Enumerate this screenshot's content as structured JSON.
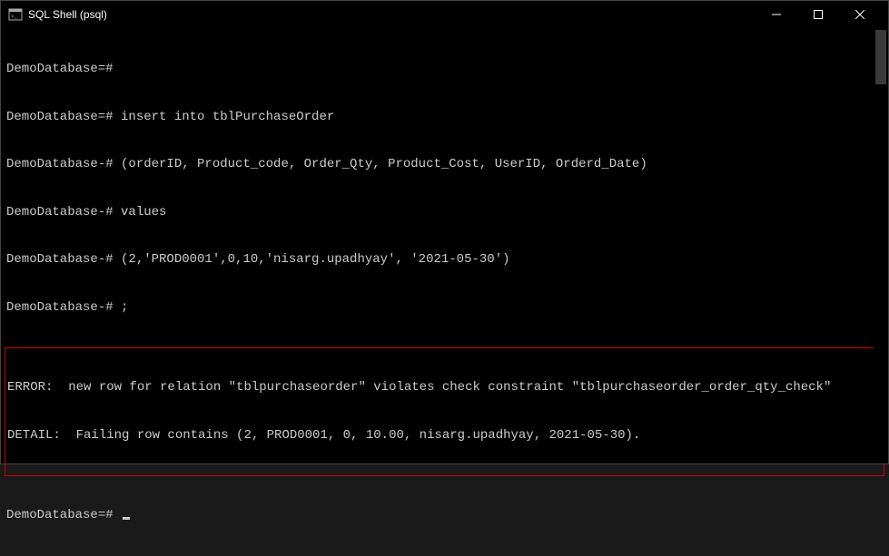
{
  "titlebar": {
    "title": "SQL Shell (psql)"
  },
  "terminal": {
    "lines": [
      "DemoDatabase=#",
      "DemoDatabase=# insert into tblPurchaseOrder",
      "DemoDatabase-# (orderID, Product_code, Order_Qty, Product_Cost, UserID, Orderd_Date)",
      "DemoDatabase-# values",
      "DemoDatabase-# (2,'PROD0001',0,10,'nisarg.upadhyay', '2021-05-30')",
      "DemoDatabase-# ;"
    ],
    "error_lines": [
      "ERROR:  new row for relation \"tblpurchaseorder\" violates check constraint \"tblpurchaseorder_order_qty_check\"",
      "DETAIL:  Failing row contains (2, PROD0001, 0, 10.00, nisarg.upadhyay, 2021-05-30)."
    ],
    "prompt_after": "DemoDatabase=# "
  }
}
